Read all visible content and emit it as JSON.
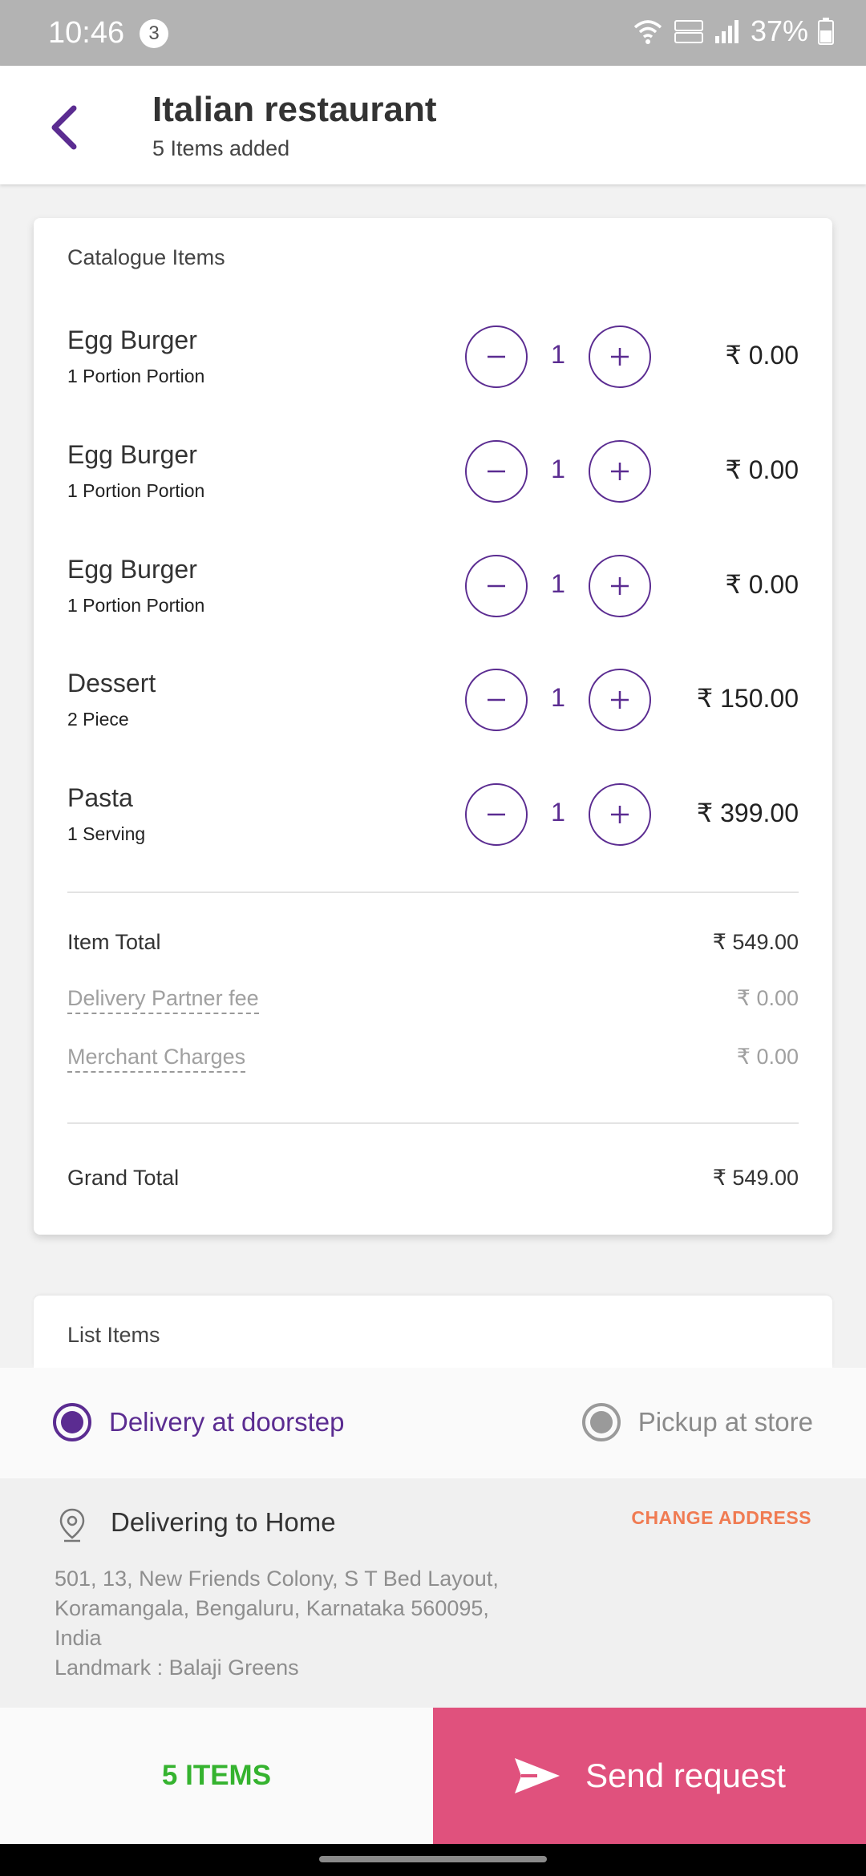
{
  "status_bar": {
    "time": "10:46",
    "notification_count": "3",
    "battery": "37%"
  },
  "header": {
    "title": "Italian restaurant",
    "subtitle": "5 Items added"
  },
  "catalogue": {
    "title": "Catalogue Items",
    "items": [
      {
        "name": "Egg Burger",
        "desc": "1 Portion Portion",
        "qty": "1",
        "price": "₹ 0.00"
      },
      {
        "name": "Egg Burger",
        "desc": "1 Portion Portion",
        "qty": "1",
        "price": "₹ 0.00"
      },
      {
        "name": "Egg Burger",
        "desc": "1 Portion Portion",
        "qty": "1",
        "price": "₹ 0.00"
      },
      {
        "name": "Dessert",
        "desc": "2 Piece",
        "qty": "1",
        "price": "₹ 150.00"
      },
      {
        "name": "Pasta",
        "desc": "1 Serving",
        "qty": "1",
        "price": "₹ 399.00"
      }
    ],
    "item_total_label": "Item Total",
    "item_total_value": "₹ 549.00",
    "delivery_fee_label": "Delivery Partner fee",
    "delivery_fee_value": "₹ 0.00",
    "merchant_label": "Merchant Charges",
    "merchant_value": "₹ 0.00",
    "grand_total_label": "Grand Total",
    "grand_total_value": "₹ 549.00"
  },
  "list_items": {
    "title": "List Items"
  },
  "delivery": {
    "option_doorstep": "Delivery at doorstep",
    "option_pickup": "Pickup at store",
    "selected": "doorstep"
  },
  "address": {
    "title": "Delivering to Home",
    "change_label": "CHANGE ADDRESS",
    "lines": [
      "501, 13, New Friends Colony, S T Bed Layout,",
      "Koramangala, Bengaluru, Karnataka 560095,",
      "India",
      "Landmark : Balaji Greens"
    ]
  },
  "bottom": {
    "items_label": "5 ITEMS",
    "send_label": "Send request"
  },
  "colors": {
    "accent": "#5b2c91",
    "send": "#e0517d",
    "items_green": "#35b32f",
    "change_orange": "#f07b52"
  }
}
